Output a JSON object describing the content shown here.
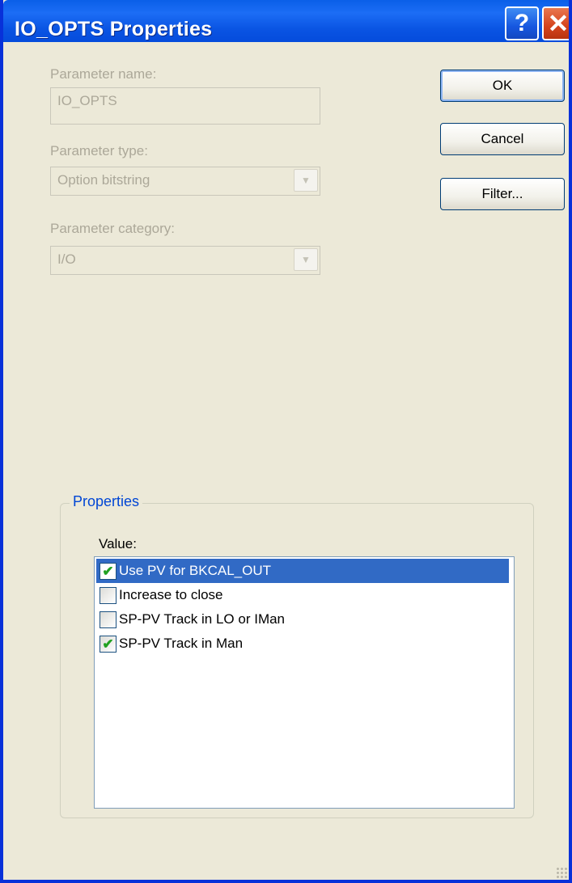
{
  "window": {
    "title": "IO_OPTS Properties",
    "help_label": "?",
    "close_label": "✕"
  },
  "form": {
    "name_label": "Parameter name:",
    "name_value": "IO_OPTS",
    "type_label": "Parameter type:",
    "type_value": "Option bitstring",
    "category_label": "Parameter category:",
    "category_value": "I/O"
  },
  "buttons": {
    "ok": "OK",
    "cancel": "Cancel",
    "filter": "Filter..."
  },
  "properties": {
    "group_title": "Properties",
    "value_label": "Value:",
    "items": [
      {
        "label": "Use PV for BKCAL_OUT",
        "checked": true,
        "selected": true
      },
      {
        "label": "Increase to close",
        "checked": false,
        "selected": false
      },
      {
        "label": "SP-PV Track in LO or IMan",
        "checked": false,
        "selected": false
      },
      {
        "label": "SP-PV Track in Man",
        "checked": true,
        "selected": false
      }
    ]
  },
  "colors": {
    "titlebar": "#0a54e3",
    "dialog_bg": "#ece9d8",
    "group_title": "#0046d5",
    "selection": "#316ac5",
    "check": "#21a121"
  },
  "icons": [
    "help-icon",
    "close-icon",
    "chevron-down-icon",
    "checkmark-icon",
    "resize-grip-icon"
  ]
}
